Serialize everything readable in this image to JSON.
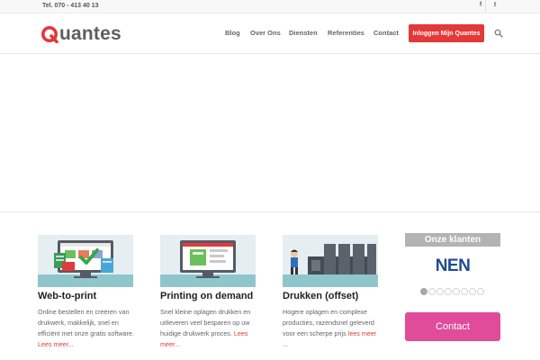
{
  "topbar": {
    "phone": "Tel. 070 - 413 40 13",
    "social": [
      {
        "icon": "facebook-icon",
        "glyph": "f"
      },
      {
        "icon": "twitter-icon",
        "glyph": "t"
      }
    ]
  },
  "header": {
    "logo_text": "uantes",
    "nav": [
      "Blog",
      "Over Ons",
      "Diensten",
      "Referenties",
      "Contact"
    ],
    "login_label": "Inloggen Mijn Quantes",
    "brand_color": "#e2393a"
  },
  "cards": [
    {
      "title": "Web-to-print",
      "desc": "Online bestellen en creëren van drukwerk, makkelijk, snel en efficiënt met onze gratis software.",
      "more": "Lees meer..."
    },
    {
      "title": "Printing on demand",
      "desc": "Snel kleine oplagen drukken en uitleveren veel besparen op uw huidige drukwerk proces.",
      "more": "Lees meer..."
    },
    {
      "title": "Drukken (offset)",
      "desc": "Hogere oplagen en complexe producties, razendsnel geleverd voor een scherpe prijs",
      "more": "lees meer ..."
    }
  ],
  "sidebar": {
    "clients_title": "Onze klanten",
    "client_logo": "NEN",
    "slider": {
      "count": 8,
      "active": 1
    },
    "contact_label": "Contact",
    "contact_color": "#e04c9a"
  }
}
